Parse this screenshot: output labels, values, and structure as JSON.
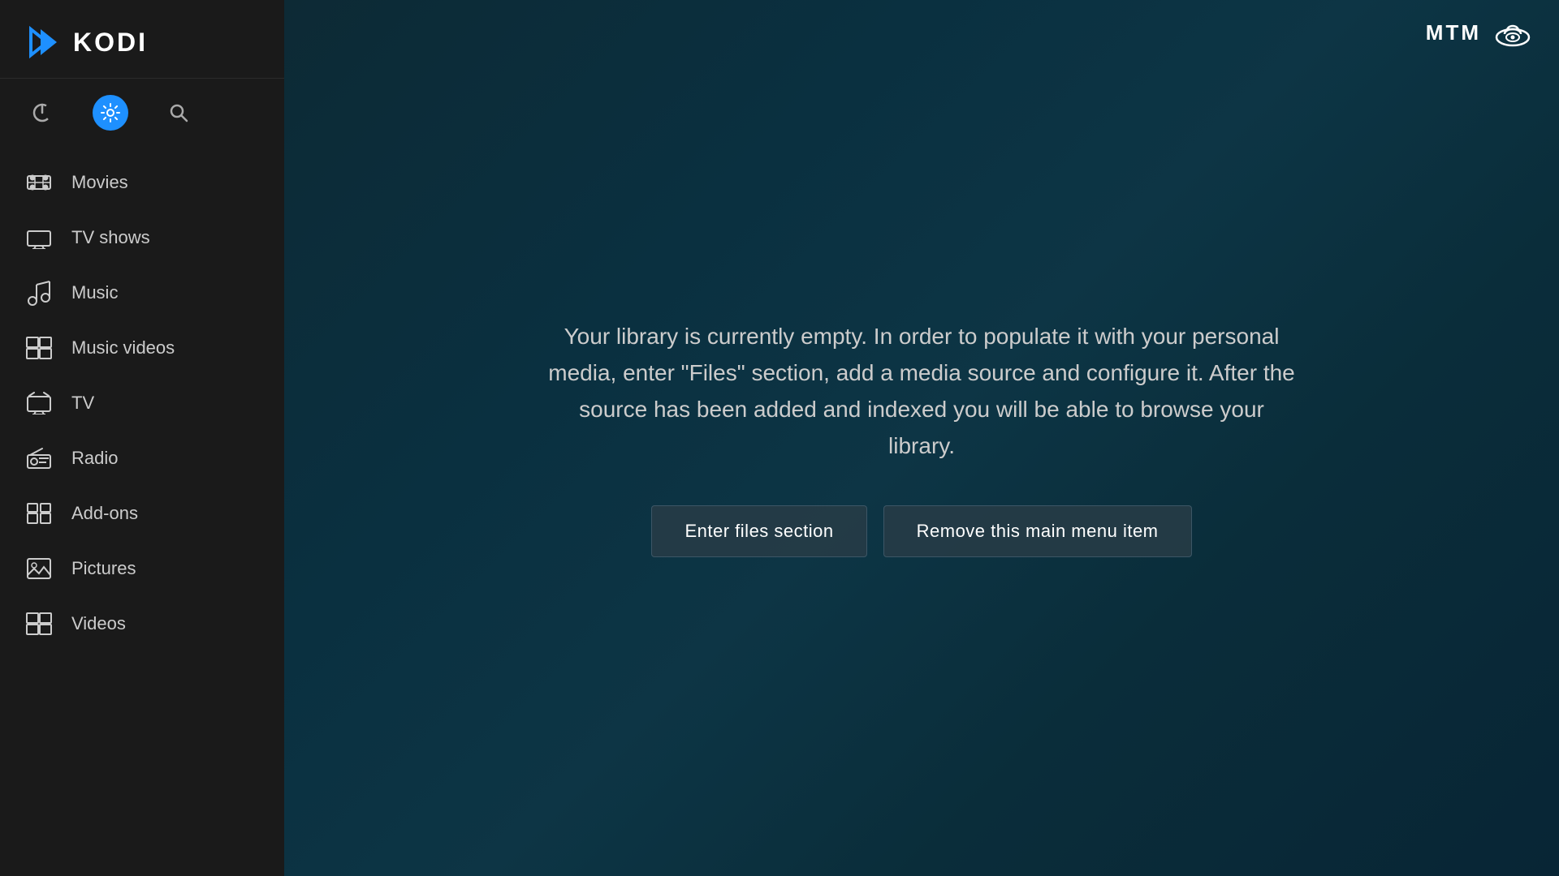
{
  "app": {
    "title": "KODI",
    "brand": "MTM"
  },
  "sidebar": {
    "power_icon": "⏻",
    "settings_icon": "⚙",
    "search_icon": "🔍",
    "nav_items": [
      {
        "id": "movies",
        "label": "Movies",
        "icon": "movies"
      },
      {
        "id": "tv-shows",
        "label": "TV shows",
        "icon": "tv-shows"
      },
      {
        "id": "music",
        "label": "Music",
        "icon": "music"
      },
      {
        "id": "music-videos",
        "label": "Music videos",
        "icon": "music-videos"
      },
      {
        "id": "tv",
        "label": "TV",
        "icon": "tv"
      },
      {
        "id": "radio",
        "label": "Radio",
        "icon": "radio"
      },
      {
        "id": "add-ons",
        "label": "Add-ons",
        "icon": "add-ons"
      },
      {
        "id": "pictures",
        "label": "Pictures",
        "icon": "pictures"
      },
      {
        "id": "videos",
        "label": "Videos",
        "icon": "videos"
      }
    ]
  },
  "main": {
    "library_message": "Your library is currently empty. In order to populate it with your personal media, enter \"Files\" section, add a media source and configure it. After the source has been added and indexed you will be able to browse your library.",
    "enter_files_label": "Enter files section",
    "remove_item_label": "Remove this main menu item"
  }
}
